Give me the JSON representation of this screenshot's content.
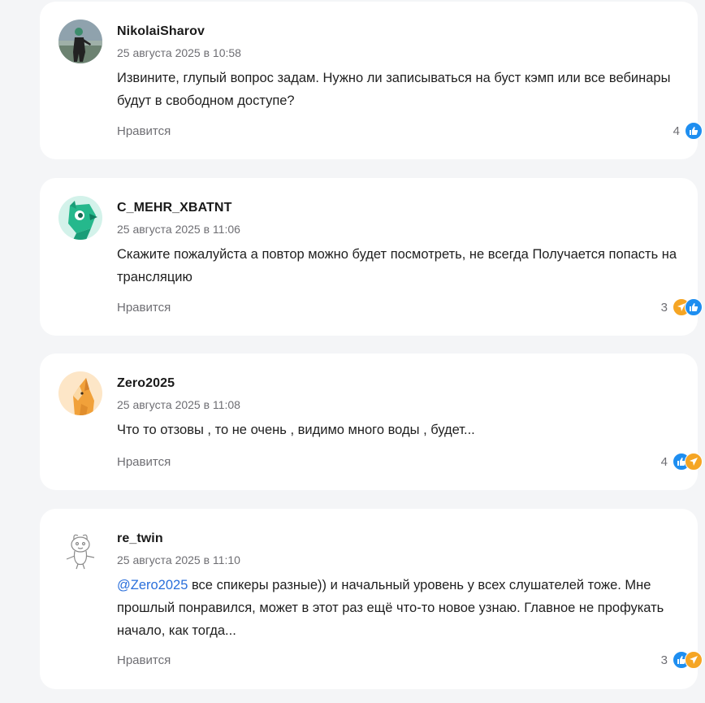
{
  "comments": [
    {
      "author": "NikolaiSharov",
      "date": "25 августа 2025 в 10:58",
      "text": "Извините, глупый вопрос задам. Нужно ли записываться на буст кэмп или все вебинары будут в свободном доступе?",
      "like_label": "Нравится",
      "reaction_count": "4",
      "reactions": [
        "like-icon"
      ]
    },
    {
      "author": "C_MEHR_XBATNT",
      "date": "25 августа 2025 в 11:06",
      "text": "Скажите пожалуйста а повтор можно будет посмотреть, не всегда Получается попасть на трансляцию",
      "like_label": "Нравится",
      "reaction_count": "3",
      "reactions": [
        "rocket-icon",
        "like-icon"
      ]
    },
    {
      "author": "Zero2025",
      "date": "25 августа 2025 в 11:08",
      "text": "Что то отзовы , то не очень , видимо много воды , будет...",
      "like_label": "Нравится",
      "reaction_count": "4",
      "reactions": [
        "like-icon",
        "rocket-icon"
      ]
    },
    {
      "author": "re_twin",
      "date": "25 августа 2025 в 11:10",
      "mention": "@Zero2025",
      "text": " все спикеры разные)) и начальный уровень у всех слушателей тоже. Мне прошлый понравился, может в этот раз ещё что-то новое узнаю. Главное не профукать начало, как тогда...",
      "like_label": "Нравится",
      "reaction_count": "3",
      "reactions": [
        "like-icon",
        "rocket-icon"
      ]
    }
  ],
  "colors": {
    "page_background": "#f4f5f7",
    "card_background": "#ffffff",
    "mention": "#2a6fdb",
    "like_reaction": "#1e8ef0",
    "rocket_reaction": "#f5a524",
    "muted_text": "#6e6e73"
  }
}
